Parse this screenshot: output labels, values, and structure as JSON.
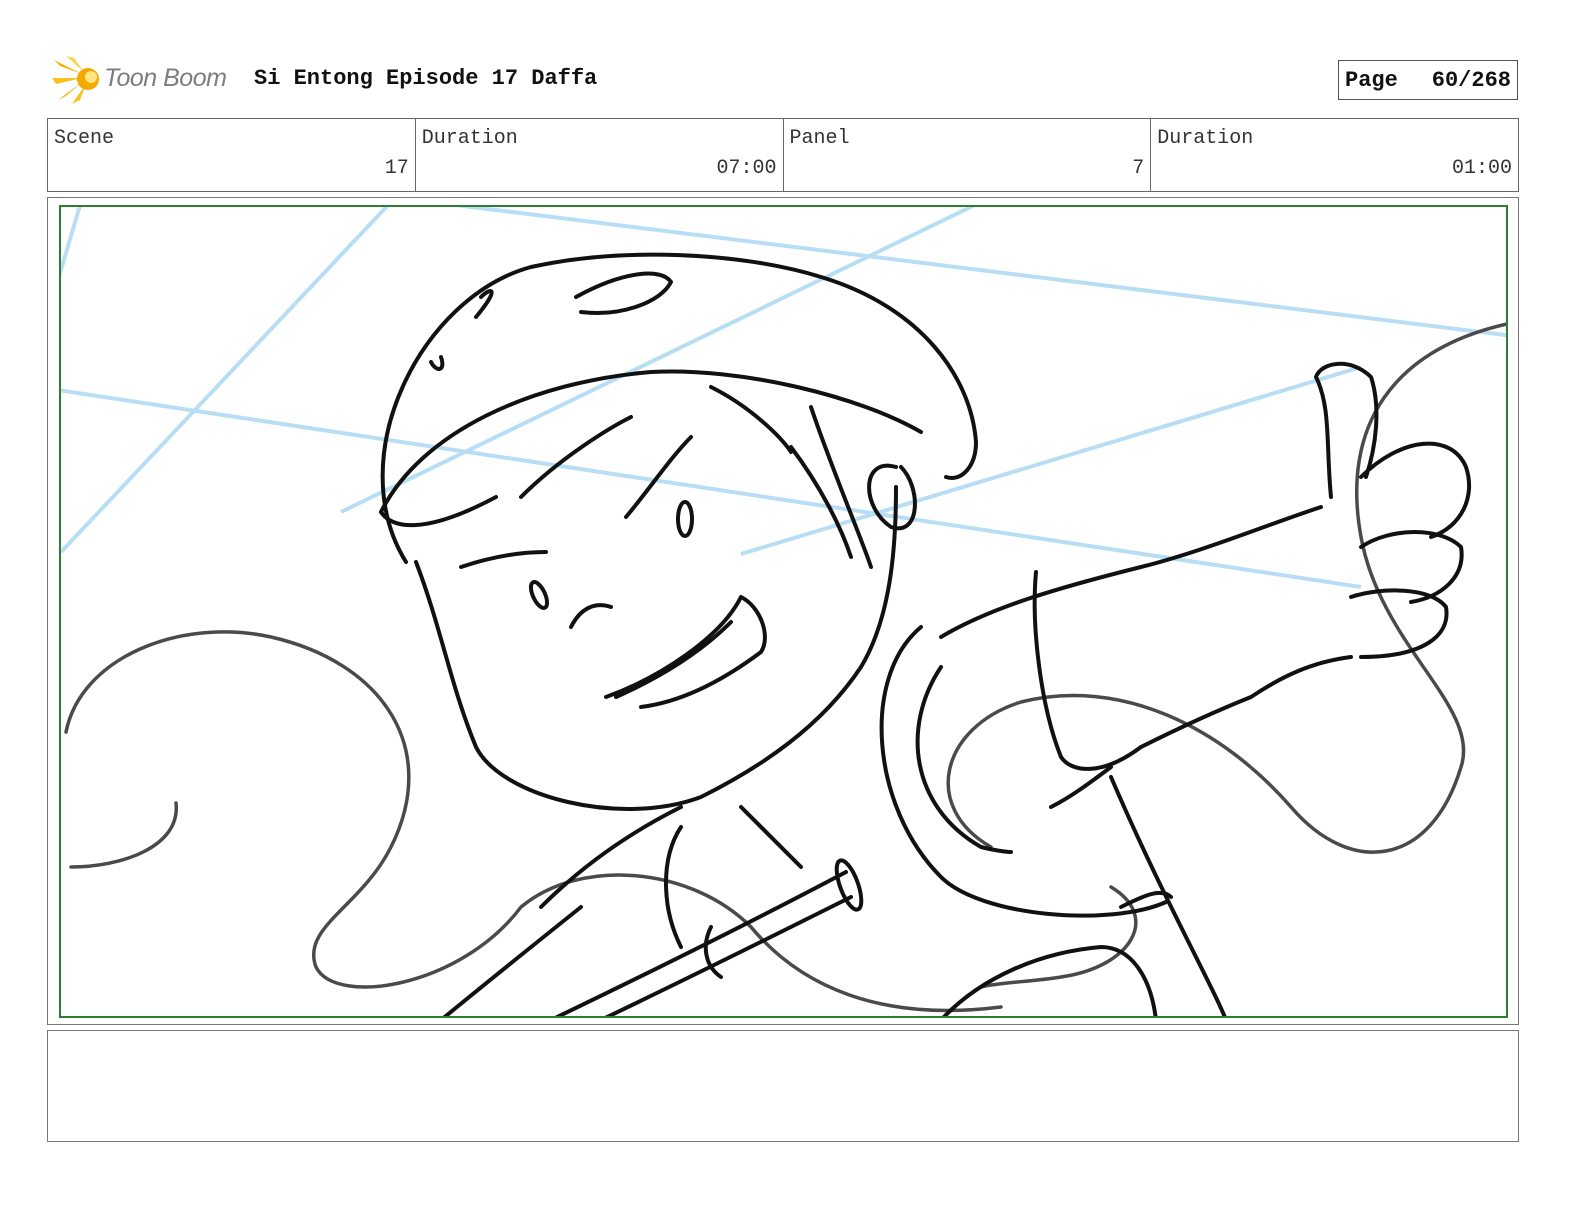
{
  "header": {
    "logo_text": "Toon Boom",
    "title": "Si Entong Episode 17 Daffa",
    "page_label": "Page",
    "page_value": "60/268"
  },
  "info": {
    "scene_label": "Scene",
    "scene_value": "17",
    "scene_duration_label": "Duration",
    "scene_duration_value": "07:00",
    "panel_label": "Panel",
    "panel_value": "7",
    "panel_duration_label": "Duration",
    "panel_duration_value": "01:00"
  },
  "colors": {
    "safe_frame": "#2e7d32",
    "guide_lines": "#b7def4",
    "sketch_ink": "#111111",
    "rough_ink": "#4a4a4a",
    "logo_flame": "#f5b400"
  },
  "icons": {
    "logo": "toon-boom-flame-icon"
  }
}
